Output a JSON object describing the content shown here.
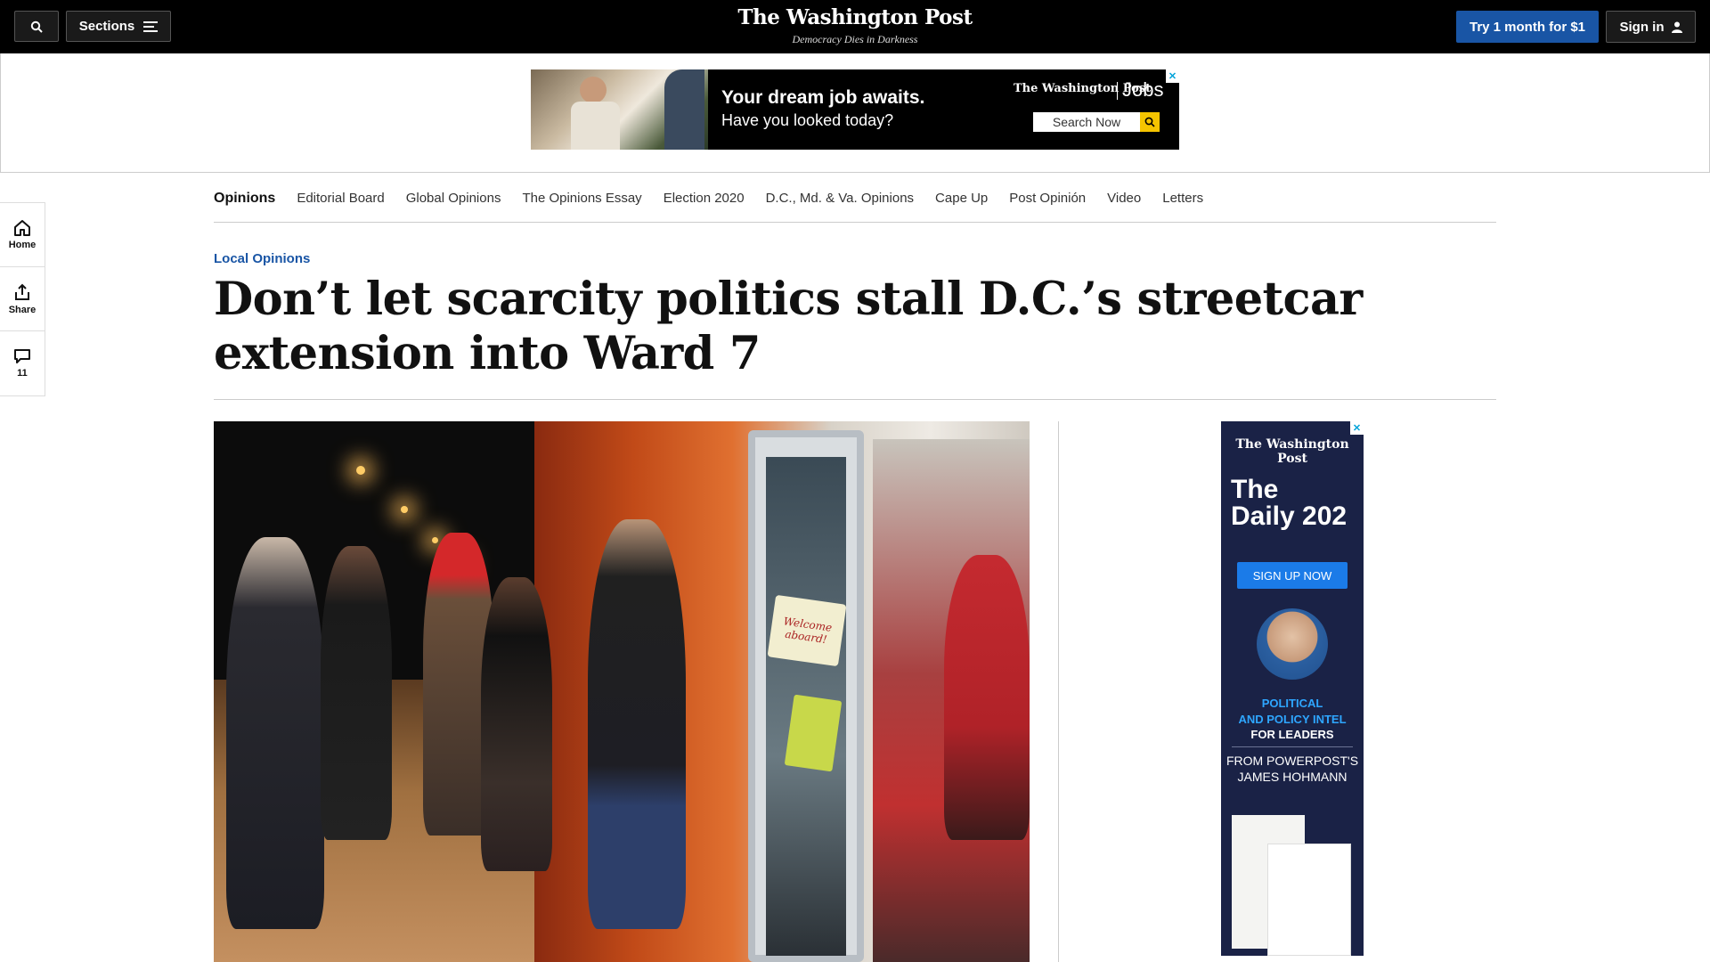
{
  "header": {
    "sections_label": "Sections",
    "logo": "The Washington Post",
    "tagline": "Democracy Dies in Darkness",
    "subscribe_label": "Try 1 month for $1",
    "signin_label": "Sign in"
  },
  "top_ad": {
    "headline": "Your dream job awaits.",
    "subline": "Have you looked today?",
    "brand": "The Washington Post",
    "product": "Jobs",
    "search_label": "Search Now"
  },
  "subnav": {
    "items": [
      "Opinions",
      "Editorial Board",
      "Global Opinions",
      "The Opinions Essay",
      "Election 2020",
      "D.C., Md. & Va. Opinions",
      "Cape Up",
      "Post Opinión",
      "Video",
      "Letters"
    ]
  },
  "left_rail": {
    "home_label": "Home",
    "share_label": "Share",
    "comments_count": "11"
  },
  "article": {
    "kicker": "Local Opinions",
    "headline": "Don’t let scarcity politics stall D.C.’s streetcar extension into Ward 7",
    "photo_sign_text": "Welcome aboard!"
  },
  "side_ad": {
    "brand": "The Washington Post",
    "title_line1": "The",
    "title_line2": "Daily 202",
    "cta": "SIGN UP NOW",
    "pitch_line1": "POLITICAL",
    "pitch_line2": "AND POLICY INTEL",
    "pitch_line3": "FOR LEADERS",
    "from_line1": "FROM POWERPOST'S",
    "from_line2": "JAMES HOHMANN"
  },
  "colors": {
    "accent": "#1955a5",
    "topbar": "#000000",
    "ad_navy": "#1a2246"
  }
}
